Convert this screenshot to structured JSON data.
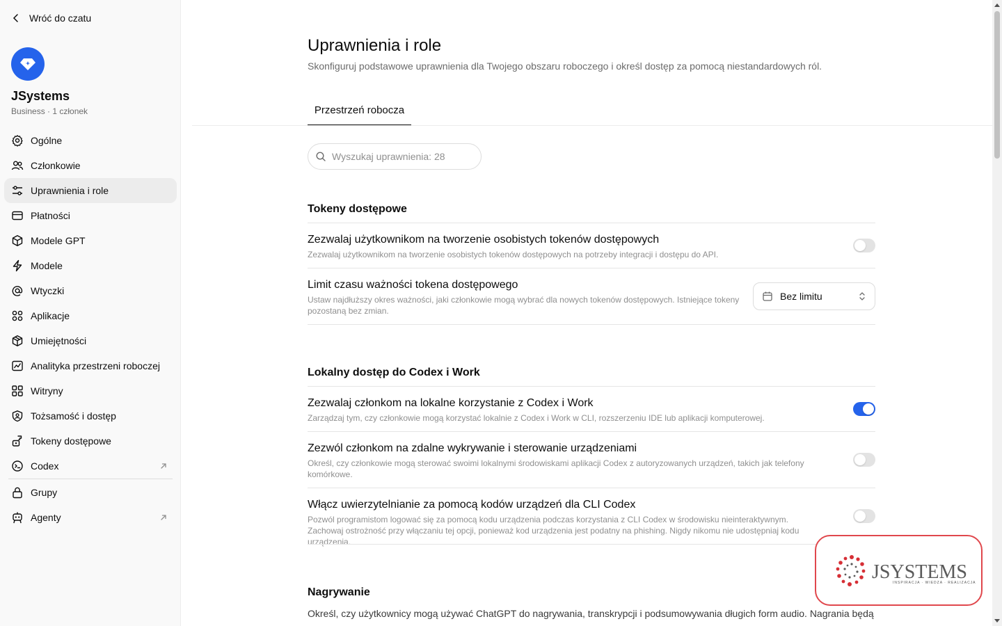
{
  "sidebar": {
    "back_label": "Wróć do czatu",
    "workspace_name": "JSystems",
    "workspace_sub": "Business · 1 członek",
    "items": [
      {
        "label": "Ogólne",
        "icon": "gear-icon"
      },
      {
        "label": "Członkowie",
        "icon": "users-icon"
      },
      {
        "label": "Uprawnienia i role",
        "icon": "sliders-icon",
        "active": true
      },
      {
        "label": "Płatności",
        "icon": "credit-card-icon"
      },
      {
        "label": "Modele GPT",
        "icon": "cube-icon"
      },
      {
        "label": "Modele",
        "icon": "bolt-icon"
      },
      {
        "label": "Wtyczki",
        "icon": "at-icon"
      },
      {
        "label": "Aplikacje",
        "icon": "apps-icon"
      },
      {
        "label": "Umiejętności",
        "icon": "box-icon"
      },
      {
        "label": "Analityka przestrzeni roboczej",
        "icon": "chart-icon"
      },
      {
        "label": "Witryny",
        "icon": "grid-icon"
      },
      {
        "label": "Tożsamość i dostęp",
        "icon": "shield-icon"
      },
      {
        "label": "Tokeny dostępowe",
        "icon": "key-icon"
      },
      {
        "label": "Codex",
        "icon": "codex-icon",
        "external": true
      }
    ],
    "items_after_sep": [
      {
        "label": "Grupy",
        "icon": "lock-icon"
      },
      {
        "label": "Agenty",
        "icon": "robot-icon",
        "external": true
      }
    ]
  },
  "header": {
    "title": "Uprawnienia i role",
    "subtitle": "Skonfiguruj podstawowe uprawnienia dla Twojego obszaru roboczego i określ dostęp za pomocą niestandardowych ról."
  },
  "tabs": [
    {
      "label": "Przestrzeń robocza",
      "active": true
    }
  ],
  "search": {
    "placeholder": "Wyszukaj uprawnienia: 28"
  },
  "sections": {
    "tokens": {
      "title": "Tokeny dostępowe",
      "rows": [
        {
          "title": "Zezwalaj użytkownikom na tworzenie osobistych tokenów dostępowych",
          "desc": "Zezwalaj użytkownikom na tworzenie osobistych tokenów dostępowych na potrzeby integracji i dostępu do API.",
          "enabled": false
        },
        {
          "title": "Limit czasu ważności tokena dostępowego",
          "desc": "Ustaw najdłuższy okres ważności, jaki członkowie mogą wybrać dla nowych tokenów dostępowych. Istniejące tokeny pozostaną bez zmian.",
          "select_value": "Bez limitu"
        }
      ]
    },
    "codex": {
      "title": "Lokalny dostęp do Codex i Work",
      "rows": [
        {
          "title": "Zezwalaj członkom na lokalne korzystanie z Codex i Work",
          "desc": "Zarządzaj tym, czy członkowie mogą korzystać lokalnie z Codex i Work w CLI, rozszerzeniu IDE lub aplikacji komputerowej.",
          "enabled": true
        },
        {
          "title": "Zezwól członkom na zdalne wykrywanie i sterowanie urządzeniami",
          "desc": "Określ, czy członkowie mogą sterować swoimi lokalnymi środowiskami aplikacji Codex z autoryzowanych urządzeń, takich jak telefony komórkowe.",
          "enabled": false
        },
        {
          "title": "Włącz uwierzytelnianie za pomocą kodów urządzeń dla CLI Codex",
          "desc": "Pozwól programistom logować się za pomocą kodu urządzenia podczas korzystania z CLI Codex w środowisku nieinteraktywnym. Zachowaj ostrożność przy włączaniu tej opcji, ponieważ kod urządzenia jest podatny na phishing. Nigdy nikomu nie udostępniaj kodu urządzenia.",
          "enabled": false
        }
      ]
    },
    "recording": {
      "title": "Nagrywanie",
      "desc": "Określ, czy użytkownicy mogą używać ChatGPT do nagrywania, transkrypcji i podsumowywania długich form audio. Nagrania będą"
    }
  },
  "watermark": {
    "text": "JSYSTEMS",
    "tagline": "INSPIRACJA · WIEDZA · REALIZACJA"
  },
  "colors": {
    "accent": "#2563eb",
    "watermark_border": "#e0474c"
  }
}
